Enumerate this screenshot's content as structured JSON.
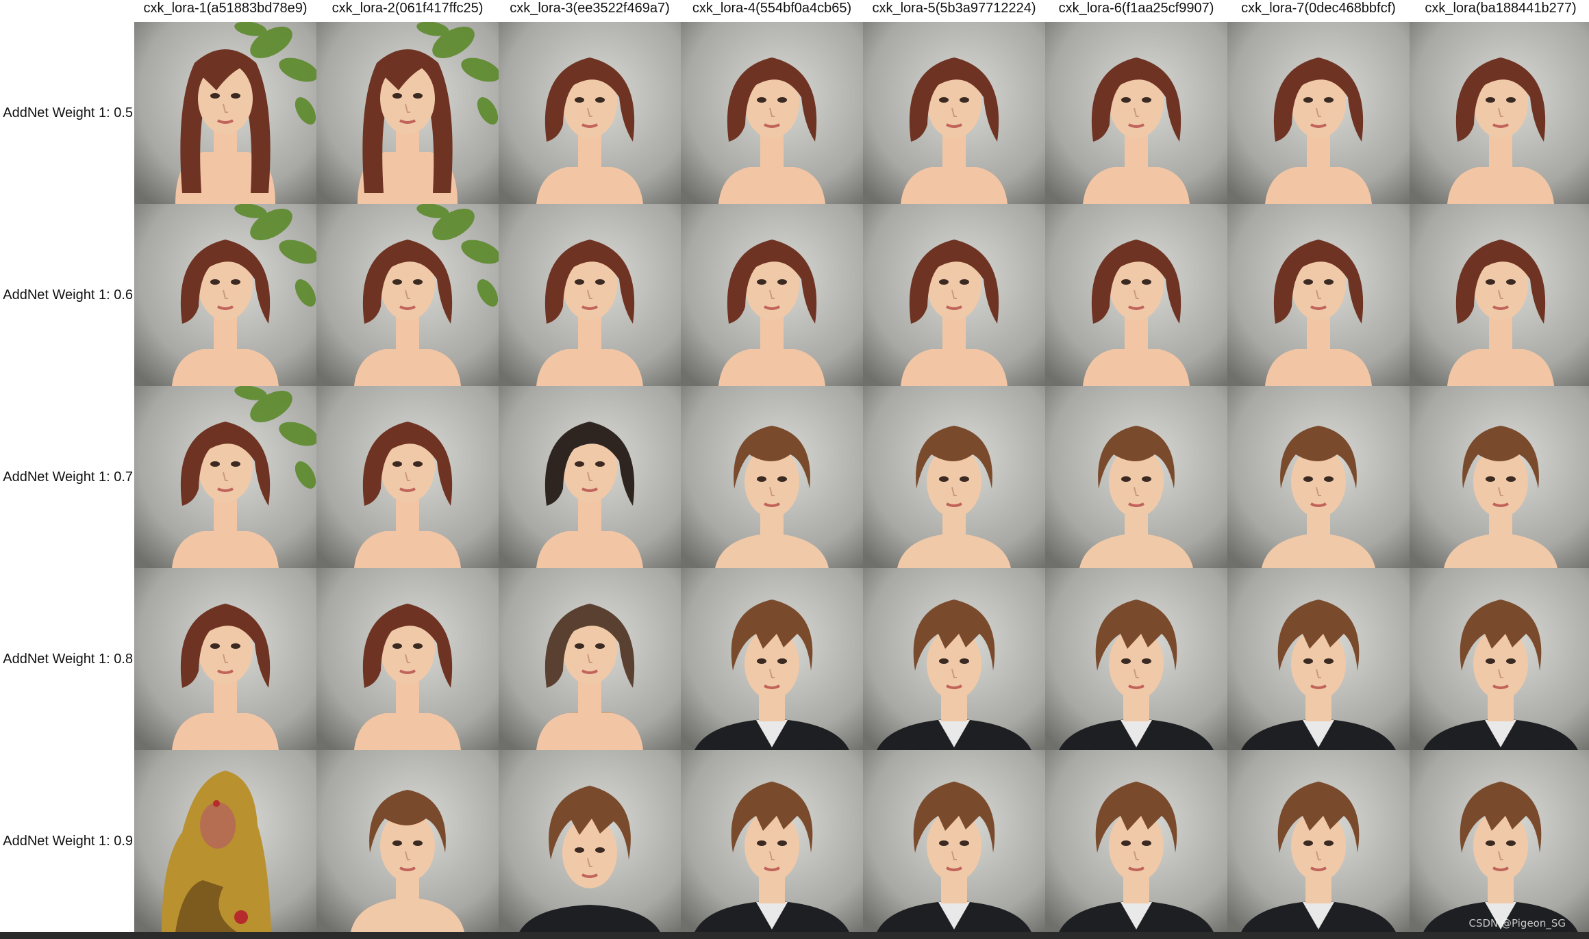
{
  "grid": {
    "columns": [
      "cxk_lora-1(a51883bd78e9)",
      "cxk_lora-2(061f417ffc25)",
      "cxk_lora-3(ee3522f469a7)",
      "cxk_lora-4(554bf0a4cb65)",
      "cxk_lora-5(5b3a97712224)",
      "cxk_lora-6(f1aa25cf9907)",
      "cxk_lora-7(0dec468bbfcf)",
      "cxk_lora(ba188441b277)"
    ],
    "rows": [
      "AddNet Weight 1: 0.5",
      "AddNet Weight 1: 0.6",
      "AddNet Weight 1: 0.7",
      "AddNet Weight 1: 0.8",
      "AddNet Weight 1: 0.9"
    ],
    "cells": [
      [
        "long-hair-mannequin-leaves",
        "long-hair-mannequin-leaves",
        "bob-mannequin",
        "bob-mannequin",
        "bob-mannequin",
        "bob-mannequin",
        "bob-mannequin",
        "bob-mannequin"
      ],
      [
        "bob-mannequin-leaves",
        "bob-mannequin-leaves",
        "bob-mannequin",
        "bob-mannequin",
        "bob-mannequin",
        "bob-mannequin",
        "bob-mannequin",
        "bob-mannequin"
      ],
      [
        "bob-mannequin-leaves",
        "bob-mannequin",
        "dark-bob-mannequin",
        "short-hair-face",
        "short-hair-face",
        "short-hair-face",
        "short-hair-face",
        "short-hair-face"
      ],
      [
        "bob-mannequin",
        "bob-mannequin",
        "bob-mannequin-stand",
        "young-man-suit",
        "young-man-suit",
        "young-man-suit",
        "young-man-suit",
        "young-man-suit"
      ],
      [
        "ornate-golden-figure",
        "short-hair-face",
        "young-man",
        "young-man-suit",
        "young-man-suit",
        "young-man-suit",
        "young-man-suit",
        "young-man-suit"
      ]
    ]
  },
  "watermark": "CSDN @Pigeon_SG",
  "colors": {
    "hair_auburn": "#6e3322",
    "hair_brown": "#7a4a2c",
    "hair_dark": "#2e2520",
    "skin": "#f0c9a8",
    "mannequin": "#f2c6a4",
    "background_gray": "#9a9a96",
    "leaves": "#5d8a2c",
    "suit": "#1e1f22",
    "gold": "#b9912f"
  }
}
